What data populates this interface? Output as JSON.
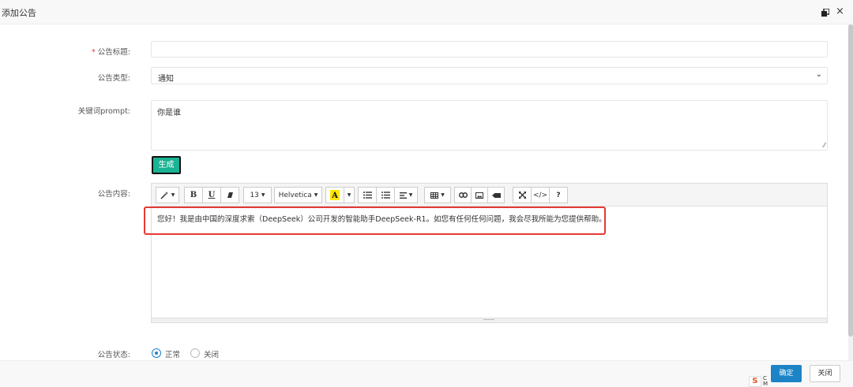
{
  "dialog": {
    "title": "添加公告",
    "maximize_icon": "restore-window-icon",
    "close_icon": "close-icon"
  },
  "form": {
    "title_label": "公告标题:",
    "title_required_mark": "*",
    "title_value": "",
    "type_label": "公告类型:",
    "type_value": "通知",
    "prompt_label": "关键词prompt:",
    "prompt_value": "你是谁",
    "generate_button": "生成",
    "content_label": "公告内容:",
    "content_value": "您好！我是由中国的深度求索（DeepSeek）公司开发的智能助手DeepSeek-R1。如您有任何任何问题，我会尽我所能为您提供帮助。",
    "status_label": "公告状态:",
    "status_options": [
      "正常",
      "关闭"
    ],
    "status_selected": "正常"
  },
  "toolbar": {
    "font_size": "13",
    "font_family": "Helvetica",
    "bold": "B",
    "underline": "U",
    "code_view": "</>",
    "help": "?",
    "icons": [
      "magic-wand-icon",
      "eraser-icon",
      "font-color-icon",
      "unordered-list-icon",
      "ordered-list-icon",
      "align-icon",
      "table-icon",
      "link-icon",
      "image-icon",
      "video-icon",
      "fullscreen-icon"
    ]
  },
  "footer": {
    "ok_button": "确定",
    "close_button": "关闭",
    "watermark_logo": "S",
    "watermark_text_1": "C",
    "watermark_text_2": "M"
  },
  "colors": {
    "primary": "#1c84c6",
    "generate": "#1ab394",
    "highlight_box": "#e53935",
    "required": "#e4393c"
  }
}
